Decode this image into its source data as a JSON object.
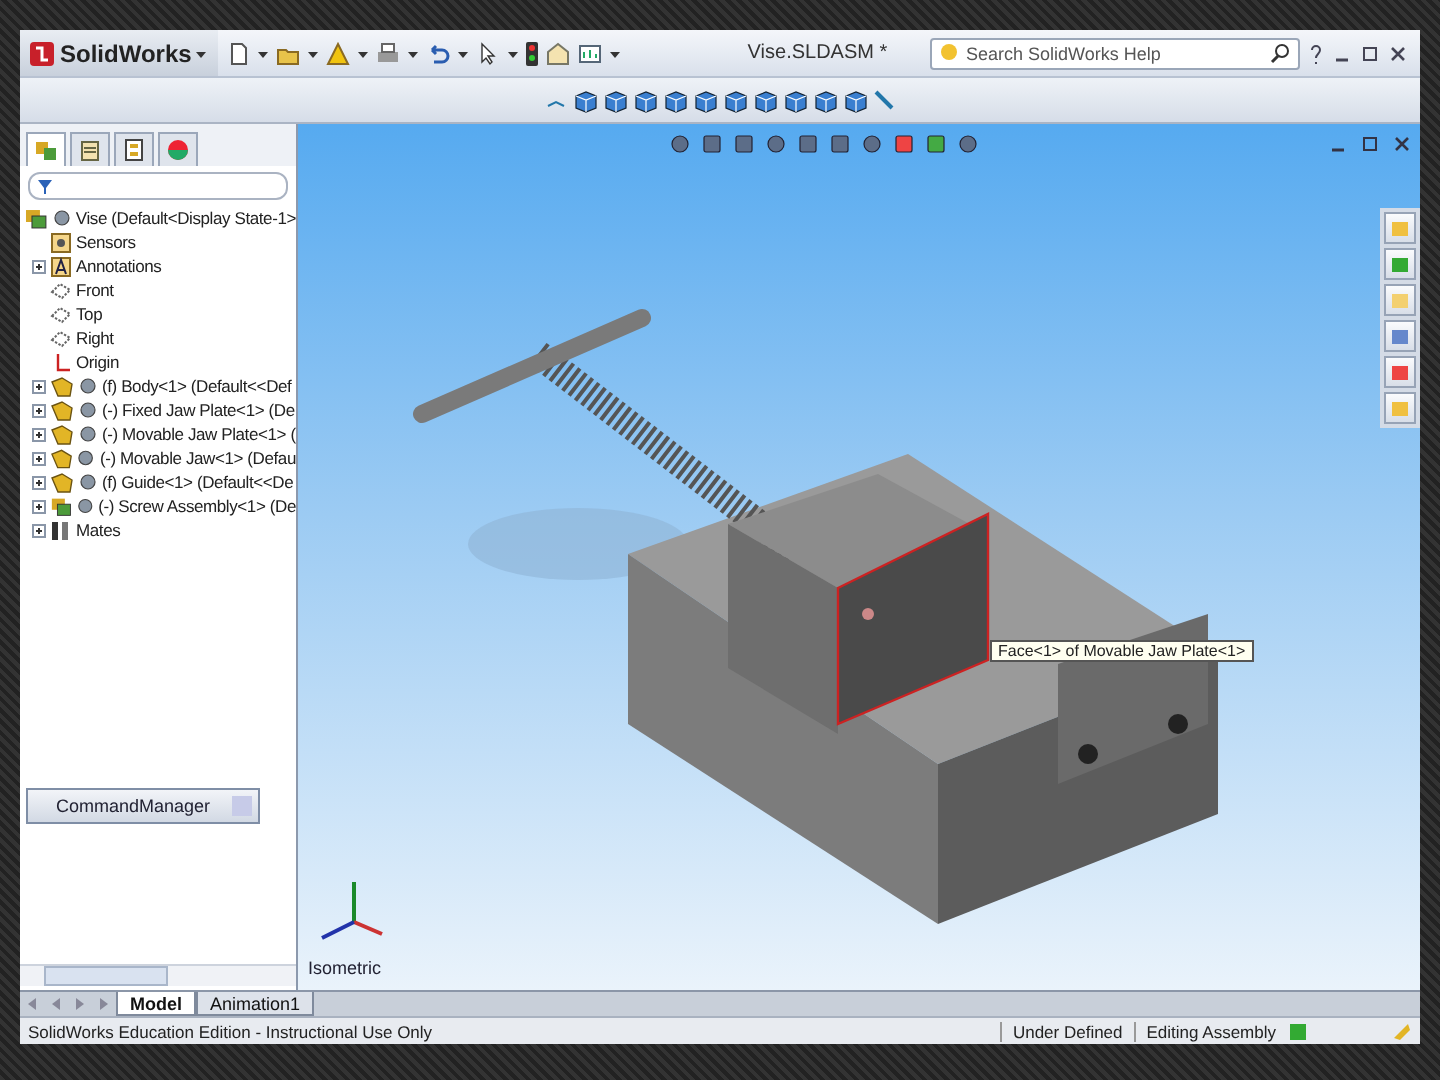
{
  "app": {
    "name": "SolidWorks"
  },
  "window": {
    "title": "Vise.SLDASM *"
  },
  "search": {
    "placeholder": "Search SolidWorks Help"
  },
  "panel_tabs": [
    {
      "kind": "tree",
      "selected": true
    },
    {
      "kind": "property",
      "selected": false
    },
    {
      "kind": "config",
      "selected": false
    },
    {
      "kind": "display",
      "selected": false
    }
  ],
  "feature_tree": {
    "root": {
      "label": "Vise  (Default<Display State-1>",
      "kind": "assembly",
      "children": [
        {
          "label": "Sensors",
          "kind": "sensors",
          "collapsed": false
        },
        {
          "label": "Annotations",
          "kind": "annotations",
          "collapsed": true
        },
        {
          "label": "Front",
          "kind": "plane",
          "collapsed": false
        },
        {
          "label": "Top",
          "kind": "plane",
          "collapsed": false
        },
        {
          "label": "Right",
          "kind": "plane",
          "collapsed": false
        },
        {
          "label": "Origin",
          "kind": "origin",
          "collapsed": false
        },
        {
          "label": "(f) Body<1> (Default<<Def",
          "kind": "part",
          "collapsed": true
        },
        {
          "label": "(-) Fixed Jaw Plate<1> (De",
          "kind": "part",
          "collapsed": true
        },
        {
          "label": "(-) Movable Jaw Plate<1> (",
          "kind": "part",
          "collapsed": true
        },
        {
          "label": "(-) Movable Jaw<1> (Defau",
          "kind": "part",
          "collapsed": true
        },
        {
          "label": "(f) Guide<1> (Default<<De",
          "kind": "part",
          "collapsed": true
        },
        {
          "label": "(-) Screw Assembly<1> (De",
          "kind": "subassembly",
          "collapsed": true
        },
        {
          "label": "Mates",
          "kind": "mates",
          "collapsed": true
        }
      ]
    }
  },
  "command_manager": {
    "label": "CommandManager"
  },
  "view": {
    "orientation": "Isometric",
    "tooltip": "Face<1> of Movable Jaw Plate<1>"
  },
  "bottom_tabs": [
    {
      "label": "Model",
      "selected": true
    },
    {
      "label": "Animation1",
      "selected": false
    }
  ],
  "status_bar": {
    "message": "SolidWorks Education Edition - Instructional Use Only",
    "fields": [
      "Under Defined",
      "Editing Assembly"
    ]
  }
}
